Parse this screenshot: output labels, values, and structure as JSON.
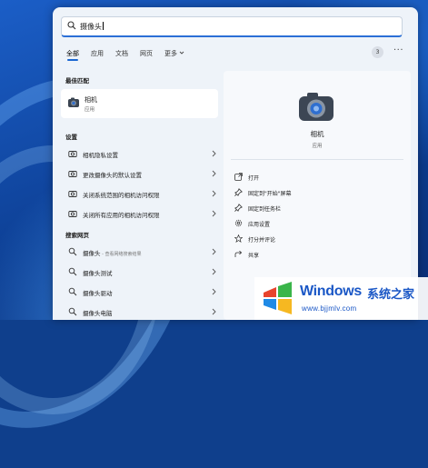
{
  "search": {
    "value": "摄像头"
  },
  "filters": [
    {
      "label": "全部",
      "active": true
    },
    {
      "label": "应用"
    },
    {
      "label": "文档"
    },
    {
      "label": "网页"
    },
    {
      "label": "更多"
    }
  ],
  "result_count": "3",
  "best_match": {
    "heading": "最佳匹配",
    "title": "相机",
    "subtitle": "应用",
    "icon": "camera-app-icon"
  },
  "settings": {
    "heading": "设置",
    "items": [
      {
        "label": "相机隐私设置",
        "icon": "camera-settings-icon"
      },
      {
        "label": "更改摄像头的默认设置",
        "icon": "camera-settings-icon"
      },
      {
        "label": "关闭系统范围的相机访问权限",
        "icon": "camera-settings-icon"
      },
      {
        "label": "关闭所有应用的相机访问权限",
        "icon": "camera-settings-icon"
      }
    ]
  },
  "web": {
    "heading": "搜索网页",
    "items": [
      {
        "label": "摄像头",
        "suffix": " - 查看网络搜索结果",
        "icon": "search-icon"
      },
      {
        "label": "摄像头测试",
        "icon": "search-icon"
      },
      {
        "label": "摄像头驱动",
        "icon": "search-icon"
      },
      {
        "label": "摄像头电脑",
        "icon": "search-icon"
      }
    ]
  },
  "detail": {
    "name": "相机",
    "type": "应用",
    "actions": [
      {
        "label": "打开",
        "icon": "open-icon"
      },
      {
        "label": "固定到\"开始\"屏幕",
        "icon": "pin-icon"
      },
      {
        "label": "固定到任务栏",
        "icon": "pin-icon"
      },
      {
        "label": "应用设置",
        "icon": "gear-icon"
      },
      {
        "label": "打分并评论",
        "icon": "star-icon"
      },
      {
        "label": "共享",
        "icon": "share-icon"
      }
    ]
  },
  "watermark": {
    "brand": "Windows",
    "brand_cn": "系统之家",
    "url": "www.bjjmlv.com"
  },
  "colors": {
    "accent": "#1a67d2",
    "watermark": "#1a57c6"
  }
}
